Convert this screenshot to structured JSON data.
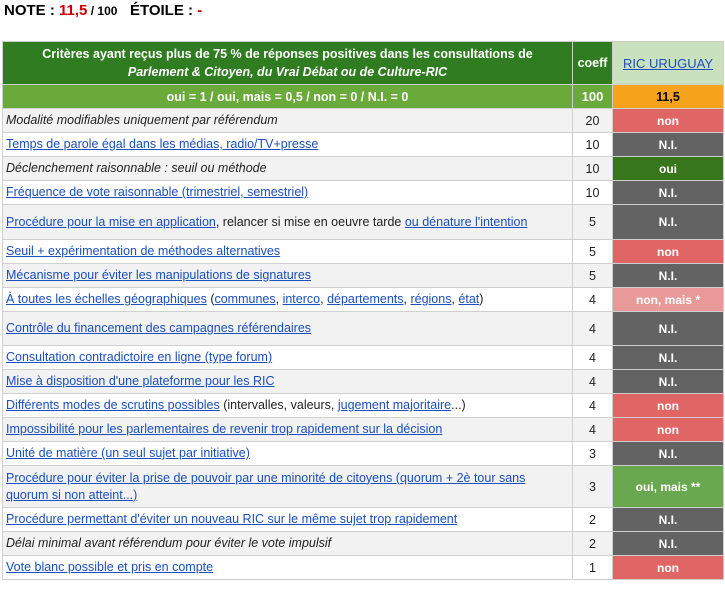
{
  "note": {
    "label": "NOTE",
    "sep": " : ",
    "score": "11,5",
    "out_of": " / 100",
    "etoile_label": "ÉTOILE",
    "etoile_value": "-"
  },
  "header": {
    "title_line1": "Critères ayant reçus  plus de  75 % de réponses positives dans les consultations de",
    "title_line2": "Parlement & Citoyen, du Vrai Débat ou de Culture-RIC",
    "coef_label": "coeff",
    "ric_link": "RIC URUGUAY"
  },
  "legend": {
    "text": "oui = 1   /   oui, mais = 0,5   /   non = 0   /   N.I. = 0",
    "coef_total": "100",
    "score": "11,5"
  },
  "rows": [
    {
      "coef": "20",
      "value": "non"
    },
    {
      "coef": "10",
      "value": "N.I."
    },
    {
      "coef": "10",
      "value": "oui"
    },
    {
      "coef": "10",
      "value": "N.I."
    },
    {
      "coef": "5",
      "value": "N.I."
    },
    {
      "coef": "5",
      "value": "non"
    },
    {
      "coef": "5",
      "value": "N.I."
    },
    {
      "coef": "4",
      "value": "non, mais *"
    },
    {
      "coef": "4",
      "value": "N.I."
    },
    {
      "coef": "4",
      "value": "N.I."
    },
    {
      "coef": "4",
      "value": "N.I."
    },
    {
      "coef": "4",
      "value": "non"
    },
    {
      "coef": "4",
      "value": "non"
    },
    {
      "coef": "3",
      "value": "N.I."
    },
    {
      "coef": "3",
      "value": "oui, mais **"
    },
    {
      "coef": "2",
      "value": "N.I."
    },
    {
      "coef": "2",
      "value": "N.I."
    },
    {
      "coef": "1",
      "value": "non"
    }
  ],
  "criteria": {
    "r0": "Modalité modifiables uniquement par référendum",
    "r1": "Temps de parole égal dans les médias, radio/TV+presse",
    "r2": "Déclenchement raisonnable : seuil ou méthode",
    "r3": "Fréquence de vote raisonnable (trimestriel, semestriel)",
    "r4_a": "Procédure pour la mise en application",
    "r4_b": ", relancer si mise en oeuvre tarde ",
    "r4_c": "ou dénature l'intention",
    "r5": "Seuil + expérimentation de méthodes alternatives",
    "r6": "Mécanisme pour éviter les manipulations de signatures",
    "r7_a": "À toutes les échelles géographiques",
    "r7_b": " (",
    "r7_c": "communes",
    "r7_d": ", ",
    "r7_e": "interco",
    "r7_f": ", ",
    "r7_g": "départements",
    "r7_h": ", ",
    "r7_i": "régions",
    "r7_j": ", ",
    "r7_k": "état",
    "r7_l": ")",
    "r8": "Contrôle du financement des campagnes référendaires",
    "r9": "Consultation contradictoire en ligne (type forum)",
    "r10": "Mise à disposition d'une plateforme pour les RIC",
    "r11_a": "Différents modes de scrutins possibles",
    "r11_b": " (intervalles, valeurs, ",
    "r11_c": "jugement majoritaire",
    "r11_d": "...)",
    "r12": "Impossibilité pour les parlementaires de revenir trop rapidement sur la décision",
    "r13": "Unité de matière (un seul sujet par initiative)",
    "r14": "Procédure pour éviter la prise de pouvoir par une minorité de citoyens (quorum + 2è tour sans quorum si non atteint...)",
    "r15": "Procédure permettant d'éviter un nouveau RIC sur le même sujet trop rapidement",
    "r16": "Délai minimal avant référendum pour éviter le vote impulsif",
    "r17": "Vote blanc possible et pris en compte"
  }
}
